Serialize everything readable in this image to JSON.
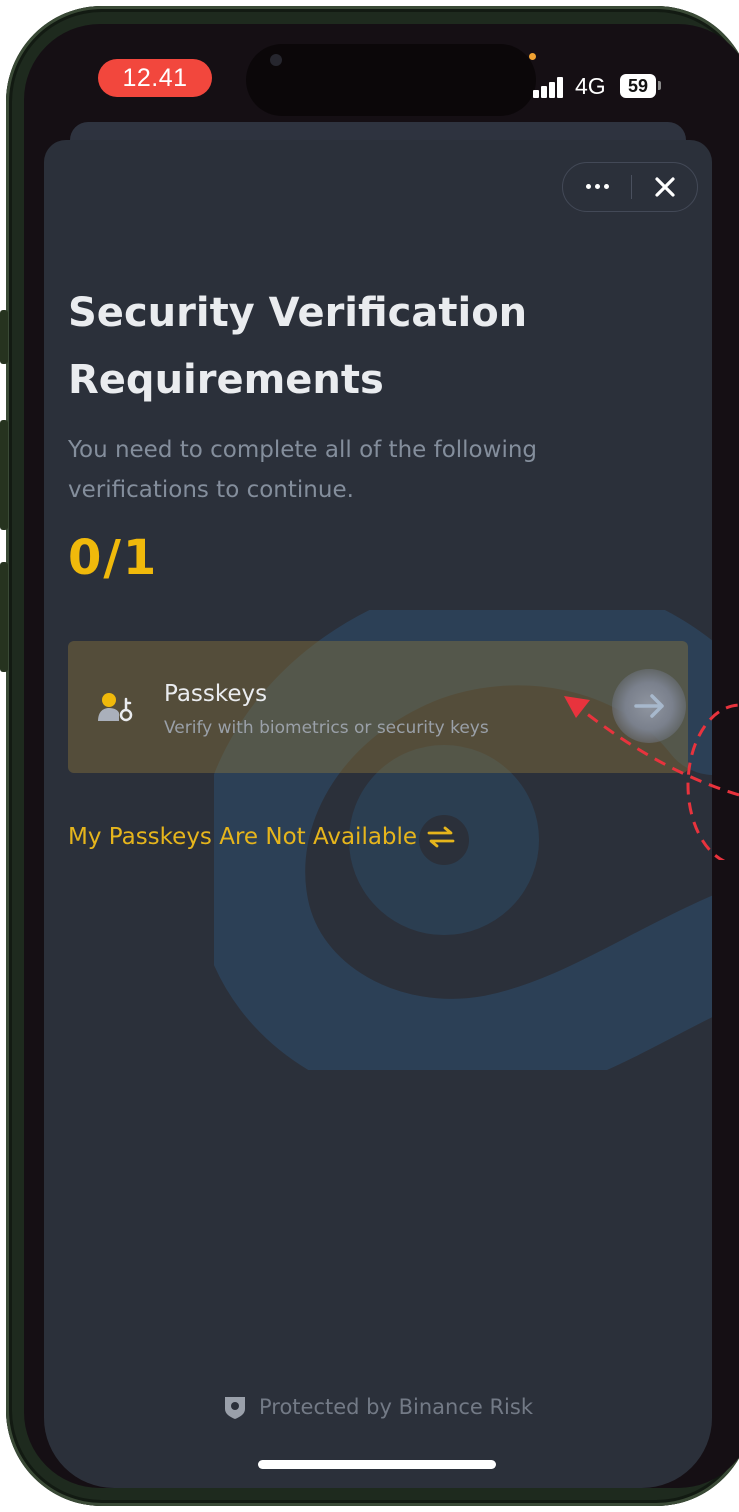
{
  "status_bar": {
    "time": "12.41",
    "network": "4G",
    "battery": "59"
  },
  "header": {
    "more_icon": "more-horizontal-icon",
    "close_icon": "close-icon"
  },
  "main": {
    "title": "Security Verification Requirements",
    "subtitle": "You need to complete all of the following verifications to continue.",
    "progress": "0/1"
  },
  "verification": {
    "icon": "user-key-icon",
    "title": "Passkeys",
    "description": "Verify with biometrics or security keys",
    "action_icon": "arrow-right-icon"
  },
  "fallback": {
    "label": "My Passkeys Are Not Available",
    "icon": "swap-icon"
  },
  "footer": {
    "text": "Protected by Binance Risk",
    "icon": "shield-icon"
  },
  "colors": {
    "accent": "#f0b90b",
    "background": "#2b303a",
    "card": "#5b5238",
    "status_time": "#f2473d",
    "annotation": "#e8333d"
  }
}
